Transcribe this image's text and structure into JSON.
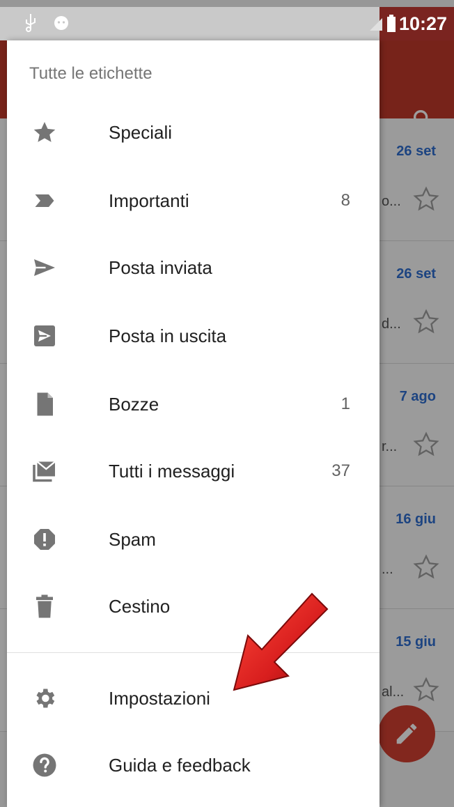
{
  "status_bar": {
    "time": "10:27"
  },
  "drawer": {
    "header": "Tutte le etichette",
    "items": [
      {
        "label": "Speciali",
        "count": "",
        "icon": "star-icon"
      },
      {
        "label": "Importanti",
        "count": "8",
        "icon": "important-icon"
      },
      {
        "label": "Posta inviata",
        "count": "",
        "icon": "send-icon"
      },
      {
        "label": "Posta in uscita",
        "count": "",
        "icon": "outbox-icon"
      },
      {
        "label": "Bozze",
        "count": "1",
        "icon": "draft-icon"
      },
      {
        "label": "Tutti i messaggi",
        "count": "37",
        "icon": "all-mail-icon"
      },
      {
        "label": "Spam",
        "count": "",
        "icon": "spam-icon"
      },
      {
        "label": "Cestino",
        "count": "",
        "icon": "trash-icon"
      }
    ],
    "footer_items": [
      {
        "label": "Impostazioni",
        "icon": "gear-icon"
      },
      {
        "label": "Guida e feedback",
        "icon": "help-icon"
      }
    ]
  },
  "background_list": {
    "dates": [
      "26 set",
      "26 set",
      "7 ago",
      "16 giu",
      "15 giu"
    ],
    "snippets": [
      "o...",
      "d...",
      "r...",
      "...",
      "al..."
    ]
  },
  "colors": {
    "appbar": "#c0392b",
    "accent_date": "#2f6fd0",
    "fab": "#d23f31",
    "icon_gray": "#757575",
    "arrow_red": "#d81e1e"
  }
}
